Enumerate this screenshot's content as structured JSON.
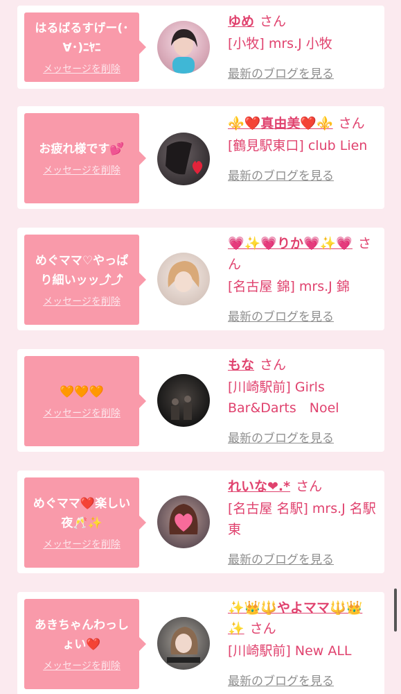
{
  "delete_label": "メッセージを削除",
  "blog_label": "最新のブログを見る",
  "san_label": "さん",
  "entries": [
    {
      "message": "はるばるすげー(･∀･)ﾆﾔﾆ",
      "name": "ゆめ",
      "shop": "[小牧] mrs.J 小牧"
    },
    {
      "message": "お疲れ様です💕",
      "name": "⚜️❤️真由美❤️⚜️",
      "shop": "[鶴見駅東口] club Lien"
    },
    {
      "message": "めぐママ♡やっぱり細いッッ⤴︎⤴︎",
      "name": "💗✨💗りか💗✨💗",
      "shop": "[名古屋 錦] mrs.J 錦"
    },
    {
      "message": "🧡🧡🧡",
      "name": "もな",
      "shop": "[川崎駅前] Girls Bar&Darts　Noel"
    },
    {
      "message": "めぐママ❤️楽しい夜🥂✨",
      "name": "れいな❤︎.*",
      "shop": "[名古屋 名駅] mrs.J 名駅東"
    },
    {
      "message": "あきちゃんわっしょい❤️",
      "name": "✨👑🔱やよママ🔱👑✨",
      "shop": "[川崎駅前] New ALL"
    }
  ],
  "avatars": [
    {
      "name": "avatar-yume",
      "colors": [
        "#c7a7b3",
        "#f3d9e2"
      ]
    },
    {
      "name": "avatar-mayumi",
      "colors": [
        "#2f2a2d",
        "#6c6265"
      ]
    },
    {
      "name": "avatar-rika",
      "colors": [
        "#d8c8c0",
        "#f4e8e0"
      ]
    },
    {
      "name": "avatar-mona",
      "colors": [
        "#141414",
        "#4a4440"
      ]
    },
    {
      "name": "avatar-reina",
      "colors": [
        "#5a4a52",
        "#b99a94"
      ]
    },
    {
      "name": "avatar-yayo",
      "colors": [
        "#4c4a4a",
        "#a8a29a"
      ]
    }
  ]
}
